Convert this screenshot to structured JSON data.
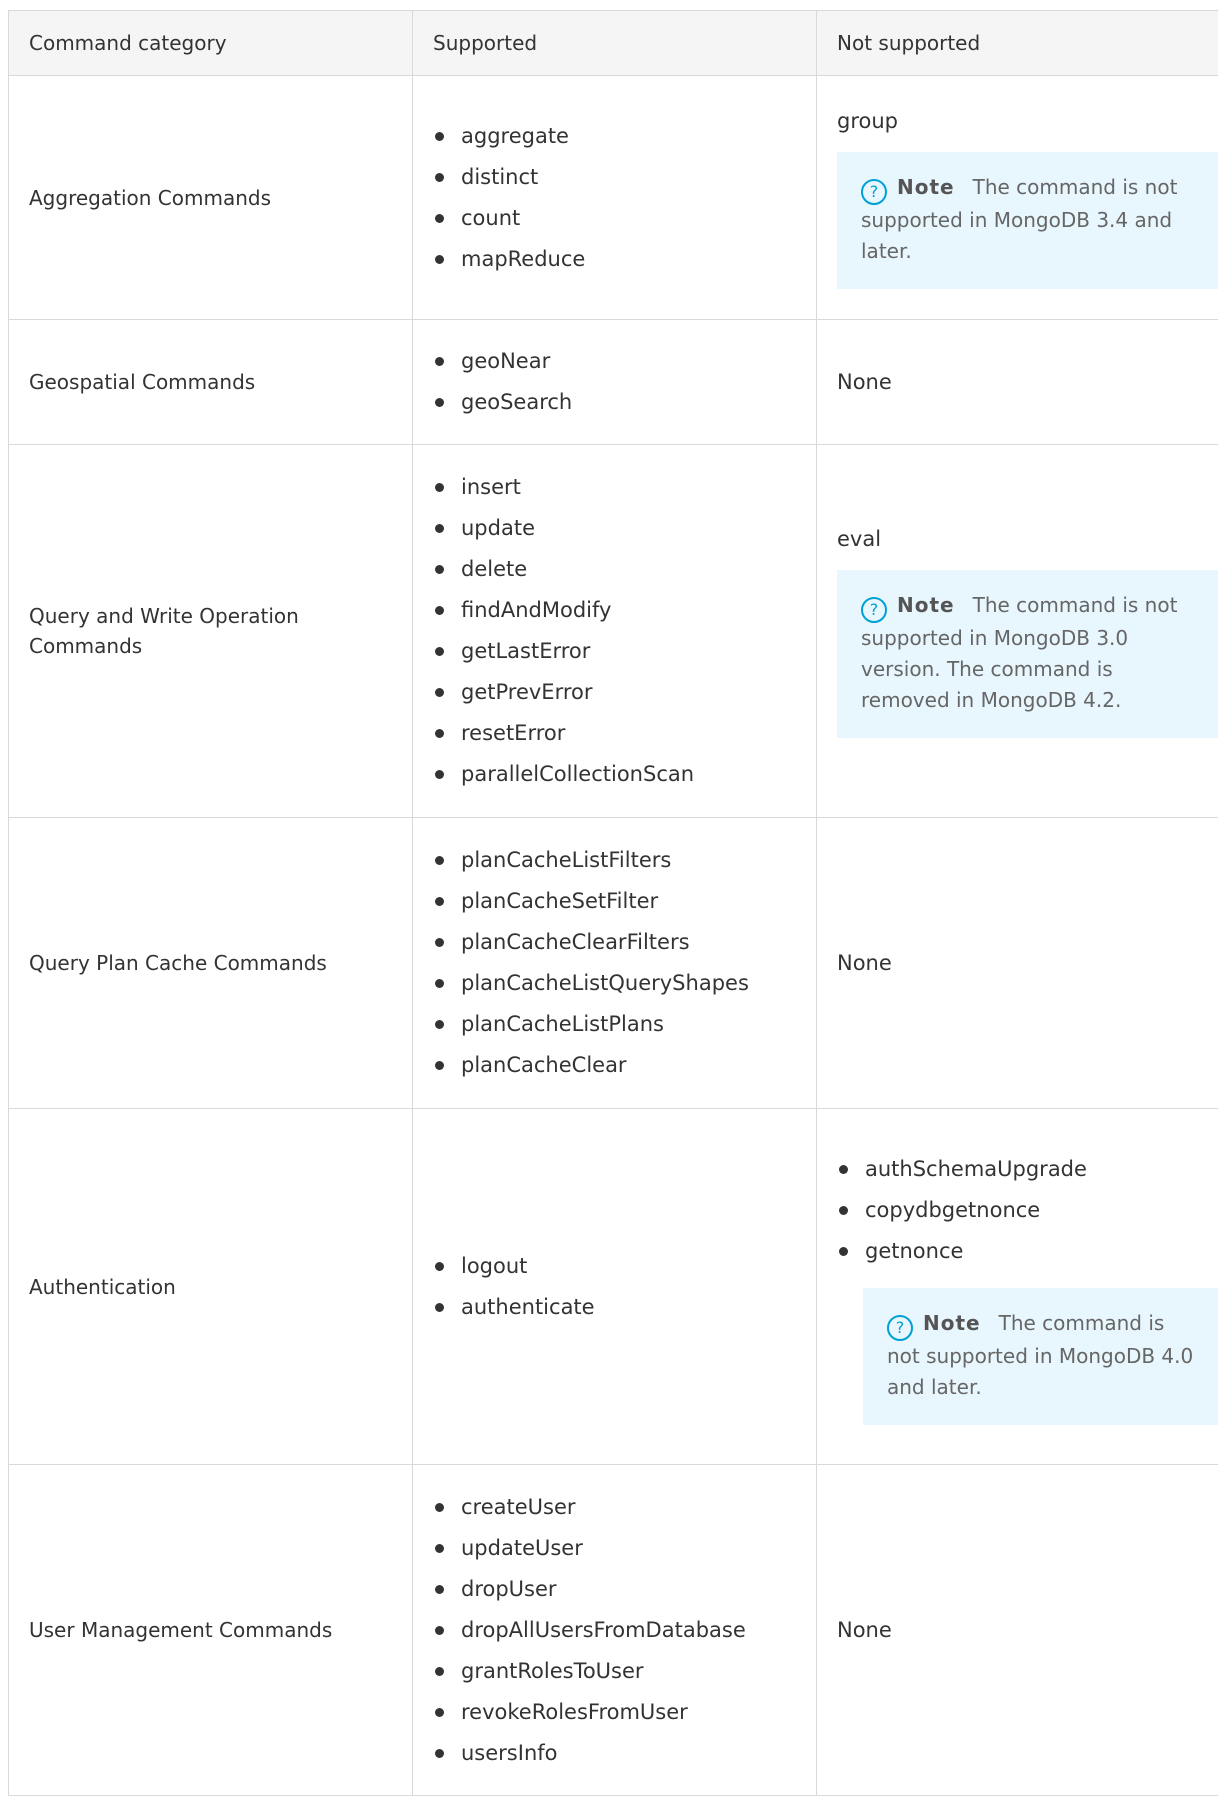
{
  "columns": [
    "Command category",
    "Supported",
    "Not supported"
  ],
  "note_label": "Note",
  "rows": [
    {
      "category": "Aggregation Commands",
      "supported": [
        "aggregate",
        "distinct",
        "count",
        "mapReduce"
      ],
      "not_supported": "group",
      "note": "The command is not supported in MongoDB 3.4 and later."
    },
    {
      "category": "Geospatial Commands",
      "supported": [
        "geoNear",
        "geoSearch"
      ],
      "not_supported": "None"
    },
    {
      "category": "Query and Write Operation Commands",
      "supported": [
        "insert",
        "update",
        "delete",
        "findAndModify",
        "getLastError",
        "getPrevError",
        "resetError",
        "parallelCollectionScan"
      ],
      "not_supported": "eval",
      "note": "The command is not supported in MongoDB 3.0 version. The command is removed in MongoDB 4.2."
    },
    {
      "category": "Query Plan Cache Commands",
      "supported": [
        "planCacheListFilters",
        "planCacheSetFilter",
        "planCacheClearFilters",
        "planCacheListQueryShapes",
        "planCacheListPlans",
        "planCacheClear"
      ],
      "not_supported": "None"
    },
    {
      "category": "Authentication",
      "supported": [
        "logout",
        "authenticate"
      ],
      "not_supported_list": [
        "authSchemaUpgrade",
        "copydbgetnonce",
        "getnonce"
      ],
      "note": "The command is not supported in MongoDB 4.0 and later."
    },
    {
      "category": "User Management Commands",
      "supported": [
        "createUser",
        "updateUser",
        "dropUser",
        "dropAllUsersFromDatabase",
        "grantRolesToUser",
        "revokeRolesFromUser",
        "usersInfo"
      ],
      "not_supported": "None"
    }
  ]
}
